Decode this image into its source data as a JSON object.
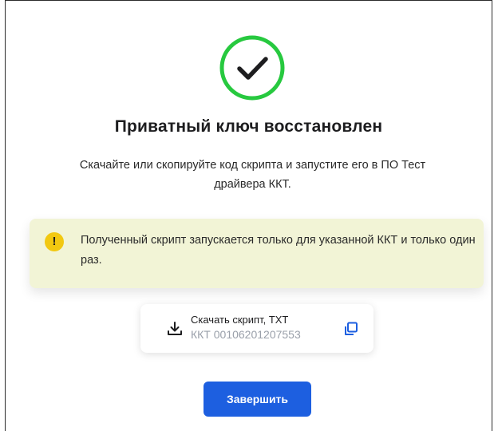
{
  "dialog": {
    "title": "Приватный ключ восстановлен",
    "subtitle": "Скачайте или скопируйте код скрипта и запустите его в ПО Тест драйвера ККТ.",
    "success_icon": "check-circle-icon",
    "success_color": "#27c93f"
  },
  "alert": {
    "icon": "exclamation-icon",
    "text": "Полученный скрипт запускается только для указанной ККТ и только один раз.",
    "background": "#f2f4d6",
    "icon_color": "#f2c811"
  },
  "download": {
    "title": "Скачать скрипт, TXT",
    "subtitle": "ККТ 00106201207553",
    "download_icon": "download-icon",
    "copy_icon": "copy-icon",
    "accent": "#1d5fe0"
  },
  "actions": {
    "finish_label": "Завершить",
    "color": "#1d5fe0"
  }
}
